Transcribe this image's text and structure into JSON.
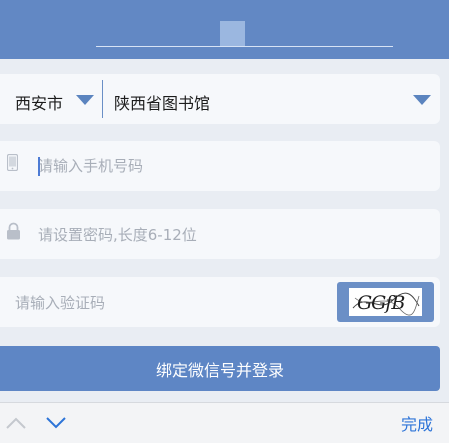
{
  "location": {
    "city": "西安市",
    "library": "陕西省图书馆"
  },
  "fields": {
    "phone_placeholder": "请输入手机号码",
    "password_placeholder": "请设置密码,长度6-12位",
    "captcha_placeholder": "请输入验证码",
    "captcha_code": "GGfB"
  },
  "actions": {
    "bind_login_label": "绑定微信号并登录"
  },
  "keyboard": {
    "done_label": "完成"
  },
  "colors": {
    "header": "#6288c4",
    "button": "#5e86c5",
    "accent": "#2d74d8"
  }
}
